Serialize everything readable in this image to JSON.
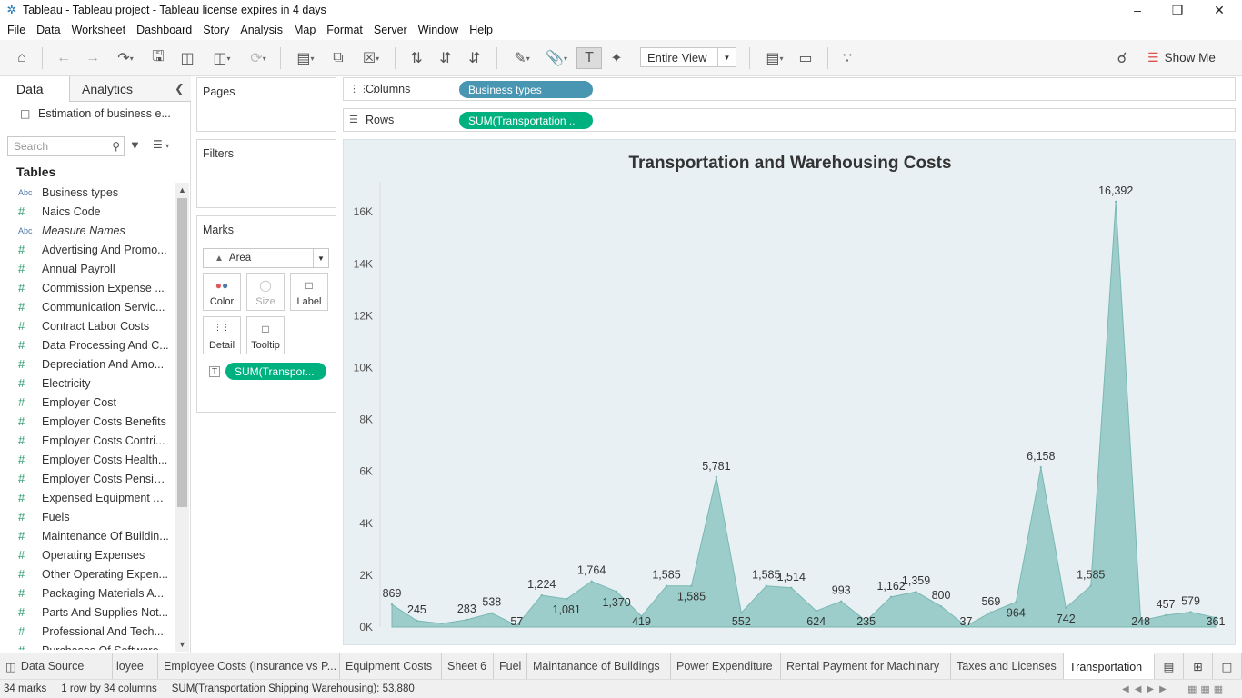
{
  "window": {
    "title": "Tableau - Tableau project - Tableau license expires in 4 days"
  },
  "menu": [
    "File",
    "Data",
    "Worksheet",
    "Dashboard",
    "Story",
    "Analysis",
    "Map",
    "Format",
    "Server",
    "Window",
    "Help"
  ],
  "toolbar": {
    "view_select": "Entire View",
    "show_me": "Show Me"
  },
  "left_pane": {
    "tab_data": "Data",
    "tab_analytics": "Analytics",
    "datasource": "Estimation of business e...",
    "search_placeholder": "Search",
    "tables_header": "Tables",
    "fields": [
      {
        "type": "Abc",
        "name": "Business types"
      },
      {
        "type": "#",
        "name": "Naics Code"
      },
      {
        "type": "Abc",
        "name": "Measure Names",
        "italic": true
      },
      {
        "type": "#",
        "name": "Advertising And Promo..."
      },
      {
        "type": "#",
        "name": "Annual Payroll"
      },
      {
        "type": "#",
        "name": "Commission Expense ..."
      },
      {
        "type": "#",
        "name": "Communication Servic..."
      },
      {
        "type": "#",
        "name": "Contract Labor Costs"
      },
      {
        "type": "#",
        "name": "Data Processing And C..."
      },
      {
        "type": "#",
        "name": "Depreciation And Amo..."
      },
      {
        "type": "#",
        "name": "Electricity"
      },
      {
        "type": "#",
        "name": "Employer Cost"
      },
      {
        "type": "#",
        "name": "Employer Costs Benefits"
      },
      {
        "type": "#",
        "name": "Employer Costs Contri..."
      },
      {
        "type": "#",
        "name": "Employer Costs Health..."
      },
      {
        "type": "#",
        "name": "Employer Costs Pensio..."
      },
      {
        "type": "#",
        "name": "Expensed Equipment A..."
      },
      {
        "type": "#",
        "name": "Fuels"
      },
      {
        "type": "#",
        "name": "Maintenance Of Buildin..."
      },
      {
        "type": "#",
        "name": "Operating Expenses"
      },
      {
        "type": "#",
        "name": "Other Operating Expen..."
      },
      {
        "type": "#",
        "name": "Packaging Materials A..."
      },
      {
        "type": "#",
        "name": "Parts And Supplies Not..."
      },
      {
        "type": "#",
        "name": "Professional And Tech..."
      },
      {
        "type": "#",
        "name": "Purchases Of Software..."
      }
    ]
  },
  "cards": {
    "pages": "Pages",
    "filters": "Filters",
    "marks": "Marks",
    "mark_type": "Area",
    "color": "Color",
    "size": "Size",
    "label": "Label",
    "detail": "Detail",
    "tooltip": "Tooltip",
    "marks_pill": "SUM(Transpor..."
  },
  "shelves": {
    "columns_label": "Columns",
    "columns_pill": "Business types",
    "rows_label": "Rows",
    "rows_pill": "SUM(Transportation .."
  },
  "chart_data": {
    "type": "area",
    "title": "Transportation and Warehousing Costs",
    "xlabel": "",
    "ylabel": "",
    "ylim": [
      0,
      17000
    ],
    "y_ticks": [
      "0K",
      "2K",
      "4K",
      "6K",
      "8K",
      "10K",
      "12K",
      "14K",
      "16K"
    ],
    "grid": false,
    "color": "#8ec7c2",
    "values": [
      869,
      245,
      138,
      283,
      538,
      57,
      1224,
      1081,
      1764,
      1370,
      419,
      1585,
      1585,
      5781,
      552,
      1585,
      1514,
      624,
      993,
      235,
      1162,
      1359,
      800,
      37,
      569,
      964,
      6158,
      742,
      1585,
      16392,
      248,
      457,
      579,
      361
    ],
    "labels": [
      "869",
      "245",
      "",
      "283",
      "538",
      "57",
      "1,224",
      "1,081",
      "1,764",
      "1,370",
      "419",
      "1,585",
      "1,585",
      "5,781",
      "552",
      "1,585",
      "1,514",
      "624",
      "993",
      "235",
      "1,162",
      "1,359",
      "800",
      "37",
      "569",
      "964",
      "6,158",
      "742",
      "1,585",
      "16,392",
      "248",
      "457",
      "579",
      "361"
    ],
    "label_pos": [
      "above",
      "above",
      "",
      "above",
      "above",
      "below",
      "above",
      "below",
      "above",
      "below",
      "below",
      "above",
      "below",
      "above",
      "below",
      "above",
      "above",
      "below",
      "above",
      "below",
      "above",
      "above",
      "above",
      "below",
      "above",
      "below",
      "above",
      "below",
      "above",
      "above",
      "below",
      "above",
      "above",
      "below"
    ]
  },
  "sheet_tabs": [
    "Data Source",
    "loyee",
    "Employee Costs (Insurance vs P...",
    "Equipment Costs",
    "Sheet 6",
    "Fuel",
    "Maintanance of Buildings",
    "Power Expenditure",
    "Rental Payment for Machinary",
    "Taxes and Licenses",
    "Transportation"
  ],
  "status": {
    "marks": "34 marks",
    "rows_cols": "1 row by 34 columns",
    "sum": "SUM(Transportation Shipping Warehousing): 53,880"
  }
}
